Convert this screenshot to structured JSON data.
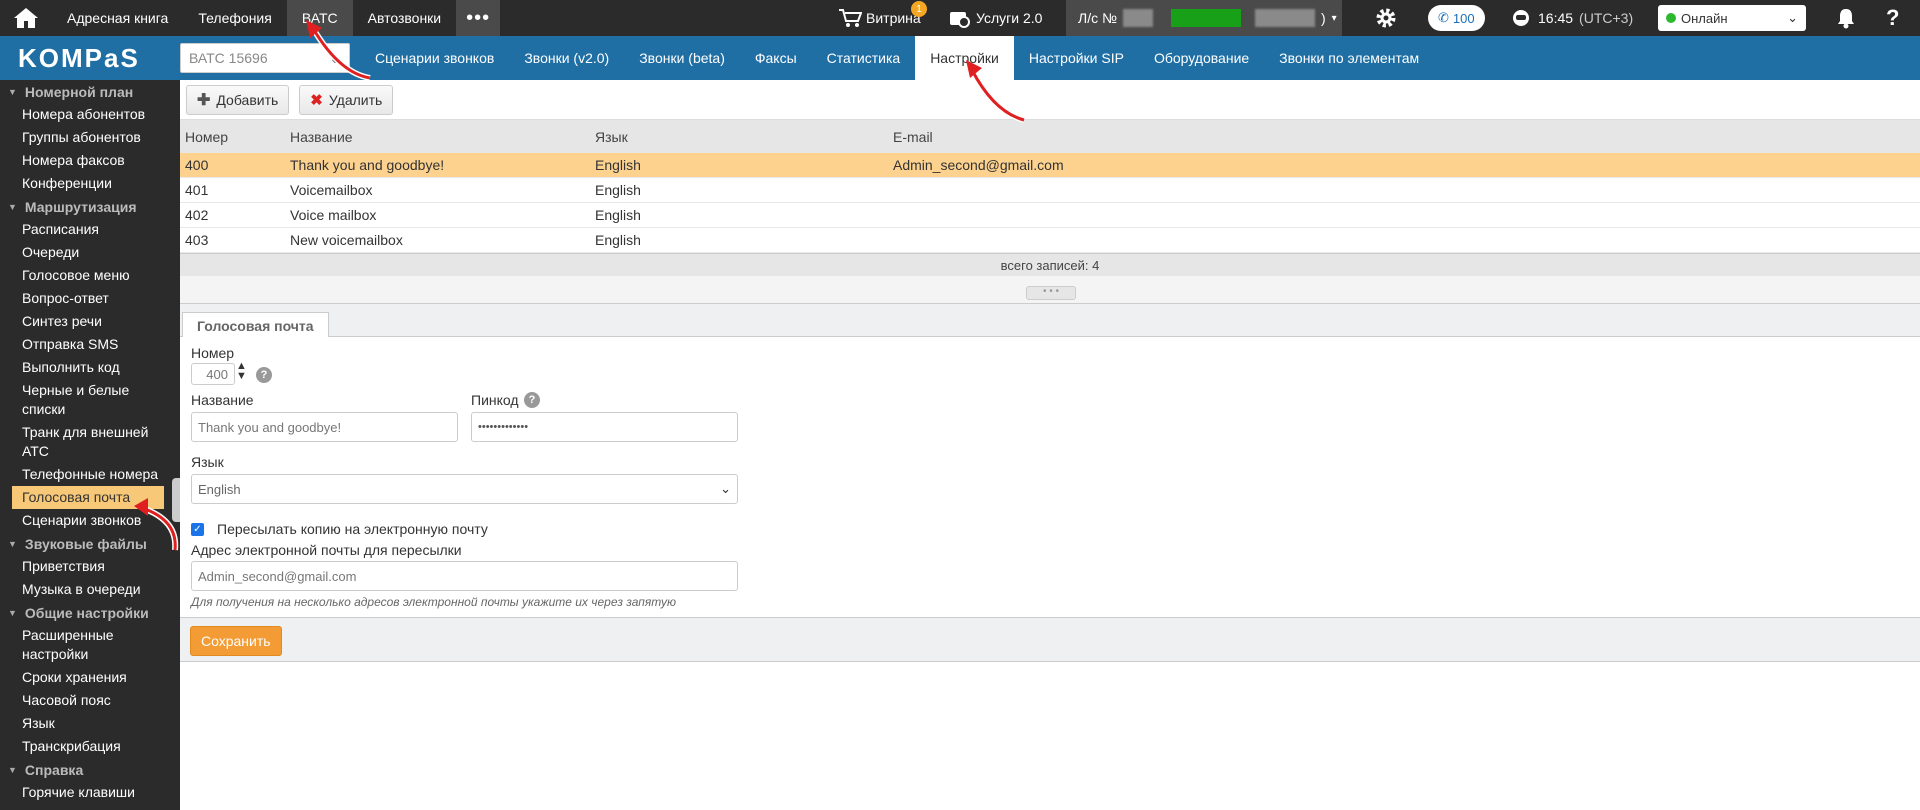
{
  "topnav": {
    "items": [
      {
        "label": "Адресная книга",
        "active": false
      },
      {
        "label": "Телефония",
        "active": false
      },
      {
        "label": "ВАТС",
        "active": true
      },
      {
        "label": "Автозвонки",
        "active": false
      }
    ],
    "more": "•••",
    "showcase": {
      "label": "Витрина",
      "badge": "1"
    },
    "services": "Услуги 2.0",
    "account_prefix": "Л/с №",
    "account_suffix": ")",
    "calls_count": "100",
    "time": "16:45",
    "tz": "(UTC+3)",
    "status": "Онлайн"
  },
  "subnav": {
    "logo": "KOMPaS",
    "vats_select": "ВАТС 15696",
    "items": [
      {
        "label": "Сценарии звонков",
        "active": false
      },
      {
        "label": "Звонки (v2.0)",
        "active": false
      },
      {
        "label": "Звонки (beta)",
        "active": false
      },
      {
        "label": "Факсы",
        "active": false
      },
      {
        "label": "Статистика",
        "active": false
      },
      {
        "label": "Настройки",
        "active": true
      },
      {
        "label": "Настройки SIP",
        "active": false
      },
      {
        "label": "Оборудование",
        "active": false
      },
      {
        "label": "Звонки по элементам",
        "active": false
      }
    ]
  },
  "sidebar": [
    {
      "group": "Номерной план",
      "items": [
        "Номера абонентов",
        "Группы абонентов",
        "Номера факсов",
        "Конференции"
      ]
    },
    {
      "group": "Маршрутизация",
      "items": [
        "Расписания",
        "Очереди",
        "Голосовое меню",
        "Вопрос-ответ",
        "Синтез речи",
        "Отправка SMS",
        "Выполнить код",
        "Черные и белые списки",
        "Транк для внешней АТС",
        "Телефонные номера",
        "Голосовая почта",
        "Сценарии звонков"
      ]
    },
    {
      "group": "Звуковые файлы",
      "items": [
        "Приветствия",
        "Музыка в очереди"
      ]
    },
    {
      "group": "Общие настройки",
      "items": [
        "Расширенные настройки",
        "Сроки хранения",
        "Часовой пояс",
        "Язык",
        "Транскрибация"
      ]
    },
    {
      "group": "Справка",
      "items": [
        "Горячие клавиши"
      ]
    }
  ],
  "sidebar_active": "Голосовая почта",
  "toolbar": {
    "add": "Добавить",
    "delete": "Удалить"
  },
  "grid": {
    "headers": [
      "Номер",
      "Название",
      "Язык",
      "E-mail"
    ],
    "rows": [
      [
        "400",
        "Thank you and goodbye!",
        "English",
        "Admin_second@gmail.com"
      ],
      [
        "401",
        "Voicemailbox",
        "English",
        ""
      ],
      [
        "402",
        "Voice mailbox",
        "English",
        ""
      ],
      [
        "403",
        "New voicemailbox",
        "English",
        ""
      ]
    ],
    "selected_index": 0,
    "footer": "всего записей: 4"
  },
  "form": {
    "tab": "Голосовая почта",
    "number_label": "Номер",
    "number_value": "400",
    "name_label": "Название",
    "name_value": "Thank you and goodbye!",
    "pin_label": "Пинкод",
    "pin_value": "•••••••••••••",
    "lang_label": "Язык",
    "lang_value": "English",
    "forward_label": "Пересылать копию на электронную почту",
    "forward_checked": true,
    "email_label": "Адрес электронной почты для пересылки",
    "email_value": "Admin_second@gmail.com",
    "hint": "Для получения на несколько адресов электронной почты укажите их через запятую",
    "save": "Сохранить",
    "help": "?"
  }
}
